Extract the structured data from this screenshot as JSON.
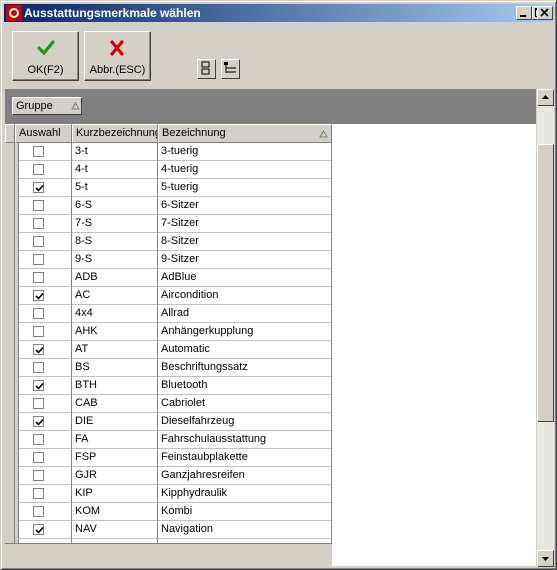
{
  "window": {
    "title": "Ausstattungsmerkmale wählen"
  },
  "toolbar": {
    "ok_label": "OK(F2)",
    "cancel_label": "Abbr.(ESC)"
  },
  "groupbar": {
    "chip_label": "Gruppe"
  },
  "grid": {
    "columns": [
      "Auswahl",
      "Kurzbezeichnung",
      "Bezeichnung"
    ],
    "rows": [
      {
        "checked": false,
        "code": "3-t",
        "name": "3-tuerig"
      },
      {
        "checked": false,
        "code": "4-t",
        "name": "4-tuerig"
      },
      {
        "checked": true,
        "code": "5-t",
        "name": "5-tuerig"
      },
      {
        "checked": false,
        "code": "6-S",
        "name": "6-Sitzer"
      },
      {
        "checked": false,
        "code": "7-S",
        "name": "7-Sitzer"
      },
      {
        "checked": false,
        "code": "8-S",
        "name": "8-Sitzer"
      },
      {
        "checked": false,
        "code": "9-S",
        "name": "9-Sitzer"
      },
      {
        "checked": false,
        "code": "ADB",
        "name": "AdBlue"
      },
      {
        "checked": true,
        "code": "AC",
        "name": "Aircondition"
      },
      {
        "checked": false,
        "code": "4x4",
        "name": "Allrad"
      },
      {
        "checked": false,
        "code": "AHK",
        "name": "Anhängerkupplung"
      },
      {
        "checked": true,
        "code": "AT",
        "name": "Automatic"
      },
      {
        "checked": false,
        "code": "BS",
        "name": "Beschriftungssatz"
      },
      {
        "checked": true,
        "code": "BTH",
        "name": "Bluetooth"
      },
      {
        "checked": false,
        "code": "CAB",
        "name": "Cabriolet"
      },
      {
        "checked": true,
        "code": "DIE",
        "name": "Dieselfahrzeug"
      },
      {
        "checked": false,
        "code": "FA",
        "name": "Fahrschulausstattung"
      },
      {
        "checked": false,
        "code": "FSP",
        "name": "Feinstaubplakette"
      },
      {
        "checked": false,
        "code": "GJR",
        "name": "Ganzjahresreifen"
      },
      {
        "checked": false,
        "code": "KIP",
        "name": "Kipphydraulik"
      },
      {
        "checked": false,
        "code": "KOM",
        "name": "Kombi"
      },
      {
        "checked": true,
        "code": "NAV",
        "name": "Navigation"
      },
      {
        "checked": false,
        "code": "",
        "name": ""
      }
    ]
  },
  "colors": {
    "title_start": "#0a246a",
    "title_end": "#a6caf0",
    "ok_check": "#1a9a1a",
    "cancel_x": "#cc0000",
    "face": "#d4d0c8"
  },
  "icons": [
    "app-icon",
    "minimize-icon",
    "maximize-icon",
    "close-icon",
    "checkmark-icon",
    "x-icon",
    "column-layout-icon",
    "tree-view-icon",
    "sort-triangle-icon",
    "scroll-up-icon",
    "scroll-down-icon"
  ]
}
